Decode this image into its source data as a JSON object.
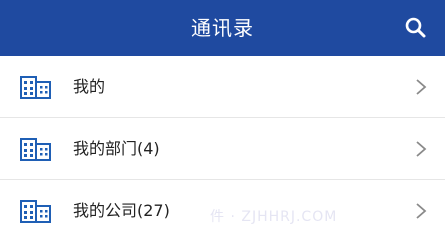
{
  "header": {
    "title": "通讯录",
    "search_icon": "search-icon",
    "background": "#1f4aa0"
  },
  "list": {
    "items": [
      {
        "label": "我的",
        "icon": "building-icon"
      },
      {
        "label": "我的部门(4)",
        "icon": "building-icon"
      },
      {
        "label": "我的公司(27)",
        "icon": "building-icon"
      }
    ],
    "chevron_icon": "chevron-right-icon"
  },
  "watermark": "件 · ZJHHRJ.COM"
}
